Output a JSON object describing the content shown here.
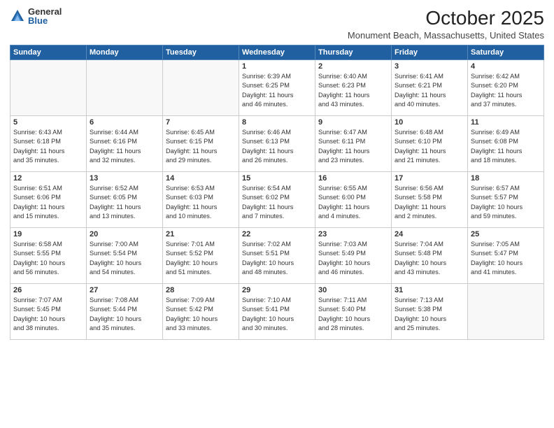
{
  "logo": {
    "general": "General",
    "blue": "Blue"
  },
  "title": "October 2025",
  "location": "Monument Beach, Massachusetts, United States",
  "headers": [
    "Sunday",
    "Monday",
    "Tuesday",
    "Wednesday",
    "Thursday",
    "Friday",
    "Saturday"
  ],
  "weeks": [
    [
      {
        "day": "",
        "info": ""
      },
      {
        "day": "",
        "info": ""
      },
      {
        "day": "",
        "info": ""
      },
      {
        "day": "1",
        "info": "Sunrise: 6:39 AM\nSunset: 6:25 PM\nDaylight: 11 hours\nand 46 minutes."
      },
      {
        "day": "2",
        "info": "Sunrise: 6:40 AM\nSunset: 6:23 PM\nDaylight: 11 hours\nand 43 minutes."
      },
      {
        "day": "3",
        "info": "Sunrise: 6:41 AM\nSunset: 6:21 PM\nDaylight: 11 hours\nand 40 minutes."
      },
      {
        "day": "4",
        "info": "Sunrise: 6:42 AM\nSunset: 6:20 PM\nDaylight: 11 hours\nand 37 minutes."
      }
    ],
    [
      {
        "day": "5",
        "info": "Sunrise: 6:43 AM\nSunset: 6:18 PM\nDaylight: 11 hours\nand 35 minutes."
      },
      {
        "day": "6",
        "info": "Sunrise: 6:44 AM\nSunset: 6:16 PM\nDaylight: 11 hours\nand 32 minutes."
      },
      {
        "day": "7",
        "info": "Sunrise: 6:45 AM\nSunset: 6:15 PM\nDaylight: 11 hours\nand 29 minutes."
      },
      {
        "day": "8",
        "info": "Sunrise: 6:46 AM\nSunset: 6:13 PM\nDaylight: 11 hours\nand 26 minutes."
      },
      {
        "day": "9",
        "info": "Sunrise: 6:47 AM\nSunset: 6:11 PM\nDaylight: 11 hours\nand 23 minutes."
      },
      {
        "day": "10",
        "info": "Sunrise: 6:48 AM\nSunset: 6:10 PM\nDaylight: 11 hours\nand 21 minutes."
      },
      {
        "day": "11",
        "info": "Sunrise: 6:49 AM\nSunset: 6:08 PM\nDaylight: 11 hours\nand 18 minutes."
      }
    ],
    [
      {
        "day": "12",
        "info": "Sunrise: 6:51 AM\nSunset: 6:06 PM\nDaylight: 11 hours\nand 15 minutes."
      },
      {
        "day": "13",
        "info": "Sunrise: 6:52 AM\nSunset: 6:05 PM\nDaylight: 11 hours\nand 13 minutes."
      },
      {
        "day": "14",
        "info": "Sunrise: 6:53 AM\nSunset: 6:03 PM\nDaylight: 11 hours\nand 10 minutes."
      },
      {
        "day": "15",
        "info": "Sunrise: 6:54 AM\nSunset: 6:02 PM\nDaylight: 11 hours\nand 7 minutes."
      },
      {
        "day": "16",
        "info": "Sunrise: 6:55 AM\nSunset: 6:00 PM\nDaylight: 11 hours\nand 4 minutes."
      },
      {
        "day": "17",
        "info": "Sunrise: 6:56 AM\nSunset: 5:58 PM\nDaylight: 11 hours\nand 2 minutes."
      },
      {
        "day": "18",
        "info": "Sunrise: 6:57 AM\nSunset: 5:57 PM\nDaylight: 10 hours\nand 59 minutes."
      }
    ],
    [
      {
        "day": "19",
        "info": "Sunrise: 6:58 AM\nSunset: 5:55 PM\nDaylight: 10 hours\nand 56 minutes."
      },
      {
        "day": "20",
        "info": "Sunrise: 7:00 AM\nSunset: 5:54 PM\nDaylight: 10 hours\nand 54 minutes."
      },
      {
        "day": "21",
        "info": "Sunrise: 7:01 AM\nSunset: 5:52 PM\nDaylight: 10 hours\nand 51 minutes."
      },
      {
        "day": "22",
        "info": "Sunrise: 7:02 AM\nSunset: 5:51 PM\nDaylight: 10 hours\nand 48 minutes."
      },
      {
        "day": "23",
        "info": "Sunrise: 7:03 AM\nSunset: 5:49 PM\nDaylight: 10 hours\nand 46 minutes."
      },
      {
        "day": "24",
        "info": "Sunrise: 7:04 AM\nSunset: 5:48 PM\nDaylight: 10 hours\nand 43 minutes."
      },
      {
        "day": "25",
        "info": "Sunrise: 7:05 AM\nSunset: 5:47 PM\nDaylight: 10 hours\nand 41 minutes."
      }
    ],
    [
      {
        "day": "26",
        "info": "Sunrise: 7:07 AM\nSunset: 5:45 PM\nDaylight: 10 hours\nand 38 minutes."
      },
      {
        "day": "27",
        "info": "Sunrise: 7:08 AM\nSunset: 5:44 PM\nDaylight: 10 hours\nand 35 minutes."
      },
      {
        "day": "28",
        "info": "Sunrise: 7:09 AM\nSunset: 5:42 PM\nDaylight: 10 hours\nand 33 minutes."
      },
      {
        "day": "29",
        "info": "Sunrise: 7:10 AM\nSunset: 5:41 PM\nDaylight: 10 hours\nand 30 minutes."
      },
      {
        "day": "30",
        "info": "Sunrise: 7:11 AM\nSunset: 5:40 PM\nDaylight: 10 hours\nand 28 minutes."
      },
      {
        "day": "31",
        "info": "Sunrise: 7:13 AM\nSunset: 5:38 PM\nDaylight: 10 hours\nand 25 minutes."
      },
      {
        "day": "",
        "info": ""
      }
    ]
  ]
}
